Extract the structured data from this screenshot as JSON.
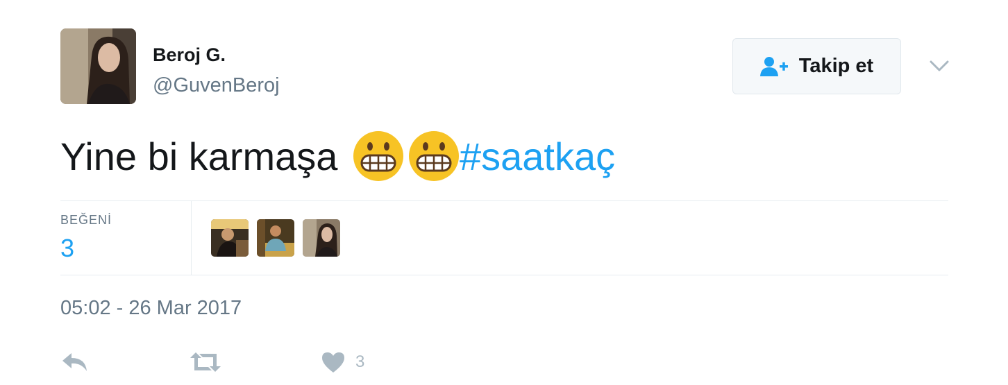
{
  "tweet": {
    "author": {
      "name": "Beroj G.",
      "handle": "@GuvenBeroj"
    },
    "follow_label": "Takip et",
    "text": "Yine bi karmaşa ",
    "emojis": [
      "grimacing-face-emoji",
      "grimacing-face-emoji"
    ],
    "hashtag": "#saatkaç",
    "stats": {
      "likes_label": "BEĞENİ",
      "likes_count": "3"
    },
    "likers": [
      "liker-1",
      "liker-2",
      "liker-3"
    ],
    "timestamp": "05:02 - 26 Mar 2017",
    "actions": {
      "like_count": "3"
    }
  },
  "colors": {
    "accent": "#1da1f2",
    "text": "#14171a",
    "muted": "#657786",
    "icon": "#aab8c2",
    "emoji": "#f7c325"
  },
  "icons": [
    "follow-icon",
    "chevron-down-icon",
    "reply-icon",
    "retweet-icon",
    "heart-icon"
  ]
}
